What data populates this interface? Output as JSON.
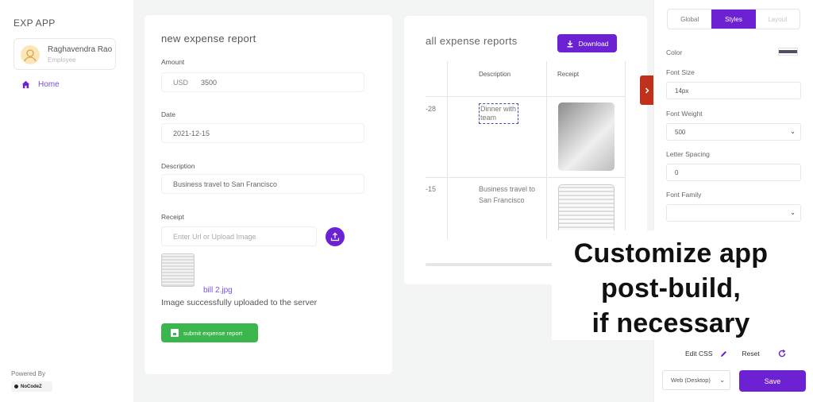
{
  "sidebar": {
    "app_title": "EXP APP",
    "user": {
      "name": "Raghavendra Rao",
      "role": "Employee"
    },
    "nav": [
      {
        "label": "Home",
        "icon": "home-icon"
      }
    ],
    "powered_by": "Powered By",
    "brand": "NoCodeZ"
  },
  "form": {
    "title": "new expense report",
    "amount_label": "Amount",
    "currency": "USD",
    "amount_value": "3500",
    "date_label": "Date",
    "date_value": "2021-12-15",
    "description_label": "Description",
    "description_value": "Business travel to San Francisco",
    "receipt_label": "Receipt",
    "receipt_placeholder": "Enter Url or Upload Image",
    "file_name": "bill 2.jpg",
    "upload_message": "Image successfully uploaded to the server",
    "submit_label": "submit expense report"
  },
  "reports": {
    "title": "all expense reports",
    "download_label": "Download",
    "columns": [
      "Description",
      "Receipt"
    ],
    "rows": [
      {
        "date_fragment": "-28",
        "description": "Dinner with team"
      },
      {
        "date_fragment": "-15",
        "description": "Business travel to San Francisco"
      }
    ]
  },
  "panel": {
    "tabs": [
      {
        "label": "Global",
        "active": false
      },
      {
        "label": "Styles",
        "active": true
      },
      {
        "label": "Layout",
        "active": false
      }
    ],
    "color_label": "Color",
    "color_value": "#4c5065",
    "font_size_label": "Font Size",
    "font_size_value": "14px",
    "font_weight_label": "Font Weight",
    "font_weight_value": "500",
    "letter_spacing_label": "Letter Spacing",
    "letter_spacing_value": "0",
    "font_family_label": "Font Family",
    "font_family_value": "",
    "edit_css_label": "Edit CSS",
    "reset_label": "Reset",
    "platform_value": "Web (Desktop)",
    "save_label": "Save"
  },
  "overlay": {
    "line1": "Customize app",
    "line2": "post-build,",
    "line3": "if necessary"
  },
  "colors": {
    "accent": "#6c22d3",
    "success": "#3ab64c",
    "side_tab": "#c0311d"
  }
}
